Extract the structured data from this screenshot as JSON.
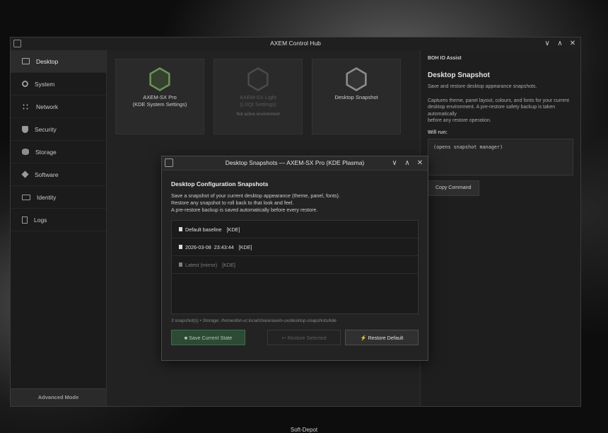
{
  "window": {
    "title": "AXEM Control Hub",
    "controls": [
      "∨",
      "∧",
      "✕"
    ]
  },
  "sidebar": {
    "items": [
      {
        "label": "Desktop",
        "icon": "monitor-icon"
      },
      {
        "label": "System",
        "icon": "gear-icon"
      },
      {
        "label": "Network",
        "icon": "network-icon"
      },
      {
        "label": "Security",
        "icon": "shield-icon"
      },
      {
        "label": "Storage",
        "icon": "disk-icon"
      },
      {
        "label": "Software",
        "icon": "package-icon"
      },
      {
        "label": "Identity",
        "icon": "id-card-icon"
      },
      {
        "label": "Logs",
        "icon": "document-icon"
      }
    ],
    "active": "Desktop",
    "advanced_label": "Advanced Mode"
  },
  "tiles": [
    {
      "line1": "AXEM-SX Pro",
      "line2": "(KDE System Settings)",
      "note": "",
      "enabled": true
    },
    {
      "line1": "AXEM-SX Light",
      "line2": "(LXQt Settings)",
      "note": "Not active environment",
      "enabled": false
    },
    {
      "line1": "Desktop Snapshot",
      "line2": "",
      "note": "",
      "enabled": true
    }
  ],
  "assist": {
    "header": "BOH IO Assist",
    "title": "Desktop Snapshot",
    "summary": "Save and restore desktop appearance snapshots.",
    "detail_lines": [
      "Captures theme, panel layout, colours, and fonts for your current",
      "desktop environment. A pre-restore safety backup is taken automatically",
      "before any restore operation."
    ],
    "will_run_label": "Will run:",
    "command": "(opens snapshot manager)",
    "copy_label": "Copy Command"
  },
  "dialog": {
    "title": "Desktop Snapshots — AXEM-SX Pro (KDE Plasma)",
    "controls": [
      "∨",
      "∧",
      "✕"
    ],
    "heading": "Desktop Configuration Snapshots",
    "description_lines": [
      "Save a snapshot of your current desktop appearance (theme, panel, fonts).",
      "Restore any snapshot to roll back to that look and feel.",
      "A pre-restore backup is saved automatically before every restore."
    ],
    "snapshots": [
      {
        "name": "Default baseline",
        "tag": "[KDE]",
        "icon": "lock-icon",
        "dim": false
      },
      {
        "name": "2026-03-08  23:43:44",
        "tag": "[KDE]",
        "icon": "snapshot-icon",
        "dim": false
      },
      {
        "name": "Latest (mirror)",
        "tag": "[KDE]",
        "icon": "snapshot-icon",
        "dim": true
      }
    ],
    "status": "3 snapshot(s)  •  Storage: /home/don-x/.local/share/axem-sx/desktop-snapshots/kde",
    "buttons": {
      "save": "■  Save Current State",
      "restore_selected": "↩  Restore Selected",
      "restore_default": "⚡  Restore Default"
    }
  },
  "wallpaper_caption": "Soft-Depot",
  "colors": {
    "accent_green": "#2d4a34",
    "tile_icon_green": "#8ab46a"
  }
}
